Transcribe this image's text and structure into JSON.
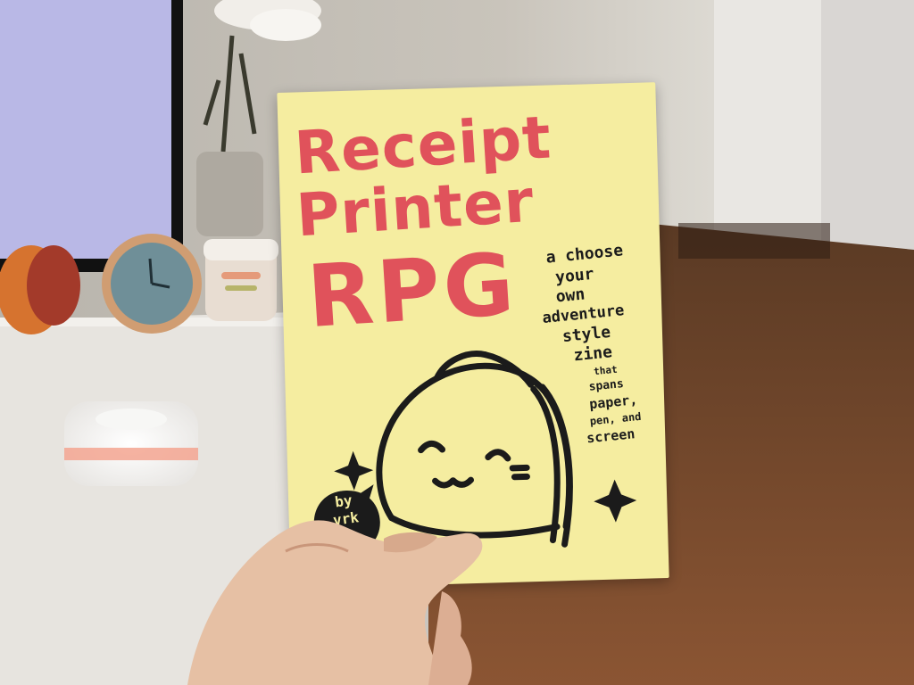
{
  "zine": {
    "title_line1": "Receipt",
    "title_line2": "Printer",
    "title_line3": "RPG",
    "tagline": [
      "a choose",
      "your",
      "own",
      "adventure",
      "style",
      "zine"
    ],
    "subtagline": [
      "that",
      "spans",
      "paper,",
      "pen, and",
      "screen"
    ],
    "byline_prefix": "by",
    "author": "vrk"
  },
  "colors": {
    "paper": "#f5eda0",
    "title_red": "#e0525b",
    "ink": "#1b1b1b",
    "floor": "#7a4a2c",
    "desk": "#e9e6e1",
    "monitor_screen": "#b9b8e6",
    "skin": "#e8c3a8"
  },
  "scene": {
    "description_icons": [
      "monitor",
      "flowers-vase",
      "clock",
      "jar",
      "mini-printer",
      "hand"
    ]
  }
}
